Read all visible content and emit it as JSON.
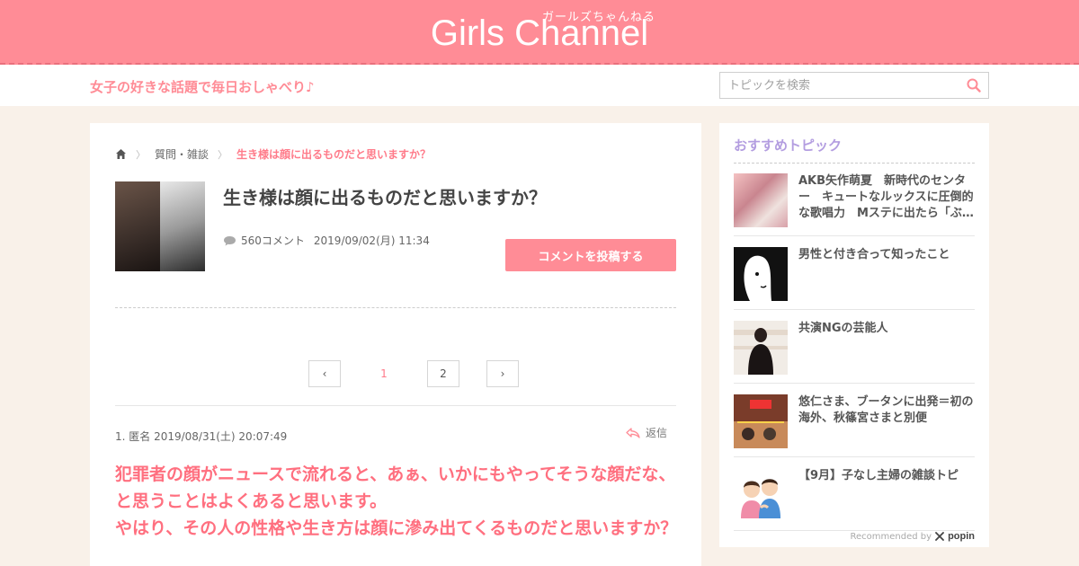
{
  "header": {
    "logo": "Girls Channel",
    "logo_kana": "ガールズちゃんねる",
    "tagline": "女子の好きな話題で毎日おしゃべり♪",
    "search_placeholder": "トピックを検索"
  },
  "breadcrumb": {
    "category": "質問・雑談",
    "current": "生き様は顔に出るものだと思いますか？"
  },
  "topic": {
    "title": "生き様は顔に出るものだと思いますか？",
    "comments": "560コメント",
    "date": "2019/09/02(月) 11:34",
    "post_button": "コメントを投稿する"
  },
  "pagination": {
    "prev": "‹",
    "pages": [
      "1",
      "2"
    ],
    "next": "›"
  },
  "comment": {
    "header": "1. 匿名 2019/08/31(土) 20:07:49",
    "reply": "返信",
    "body_line1": "犯罪者の顔がニュースで流れると、あぁ、いかにもやってそうな顔だな、と思うことはよくあると思います。",
    "body_line2": "やはり、その人の性格や生き方は顔に滲み出てくるものだと思いますか？"
  },
  "sidebar": {
    "title": "おすすめトピック",
    "items": [
      {
        "text": "AKB矢作萌夏　新時代のセンター　キュートなルックスに圧倒的な歌唱力　Mステに出たら「ぶ…"
      },
      {
        "text": "男性と付き合って知ったこと"
      },
      {
        "text": "共演NGの芸能人"
      },
      {
        "text": "悠仁さま、ブータンに出発＝初の海外、秋篠宮さまと別便"
      },
      {
        "text": "【9月】子なし主婦の雑談トピ"
      }
    ],
    "credit": "Recommended by",
    "credit_brand": "popin"
  },
  "colors": {
    "brand_pink": "#ff8c96",
    "accent_pink": "#ff6f7f",
    "sidebar_title": "#b39de0",
    "background": "#f9f1e9"
  }
}
